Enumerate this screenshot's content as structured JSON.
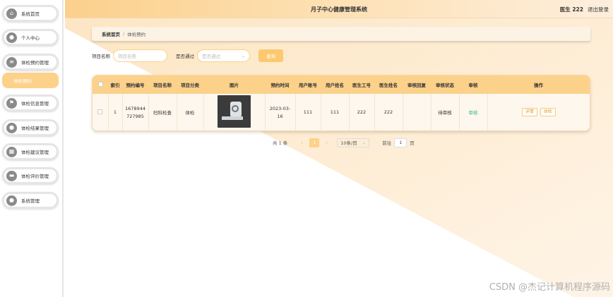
{
  "sidebar": {
    "items": [
      {
        "label": "系统首页",
        "icon": "home-icon",
        "glyph": "⌂"
      },
      {
        "label": "个人中心",
        "icon": "user-icon",
        "glyph": "●"
      },
      {
        "label": "体检预约管理",
        "icon": "list-icon",
        "glyph": "≡"
      },
      {
        "label": "体检信息管理",
        "icon": "flag-icon",
        "glyph": "⚑"
      },
      {
        "label": "体检结果管理",
        "icon": "location-icon",
        "glyph": "●"
      },
      {
        "label": "体检建议管理",
        "icon": "grid-icon",
        "glyph": "▦"
      },
      {
        "label": "体检评价管理",
        "icon": "message-icon",
        "glyph": "▬"
      },
      {
        "label": "系统管理",
        "icon": "admin-icon",
        "glyph": "●"
      }
    ],
    "active_sub": "体检预约"
  },
  "header": {
    "title": "月子中心健康管理系统",
    "user": "医生 222",
    "logout": "退出登录"
  },
  "breadcrumb": {
    "home": "系统首页",
    "separator": "/",
    "current": "体检预约"
  },
  "filters": {
    "name_label": "项目名称",
    "name_placeholder": "项目名称",
    "pass_label": "是否通过",
    "pass_placeholder": "是否通过",
    "search_label": "查询"
  },
  "table": {
    "headers": [
      "索引",
      "预约编号",
      "项目名称",
      "项目分类",
      "图片",
      "预约时间",
      "用户账号",
      "用户姓名",
      "医生工号",
      "医生姓名",
      "审核回复",
      "审核状态",
      "审核",
      "操作"
    ],
    "rows": [
      {
        "index": "1",
        "order_no_1": "1678944",
        "order_no_2": "727985",
        "item_name": "妇科检查",
        "category": "体检",
        "time_1": "2023-03-",
        "time_2": "16",
        "account": "111",
        "user_name": "111",
        "doctor_no": "222",
        "doctor_name": "222",
        "reply": "",
        "status": "待审核",
        "audit": "审核",
        "detail_btn": "详情",
        "checkup_btn": "体检"
      }
    ]
  },
  "pagination": {
    "total": "共 1 条",
    "prev": "‹",
    "current_page": "1",
    "next": "›",
    "page_size": "10条/页",
    "goto_label": "前往",
    "goto_value": "1",
    "page_unit": "页"
  },
  "watermark": "CSDN @杰记计算机程序源码",
  "colors": {
    "accent": "#fcd18a",
    "button": "#fcc96f",
    "audit_link": "#3cb38f"
  }
}
